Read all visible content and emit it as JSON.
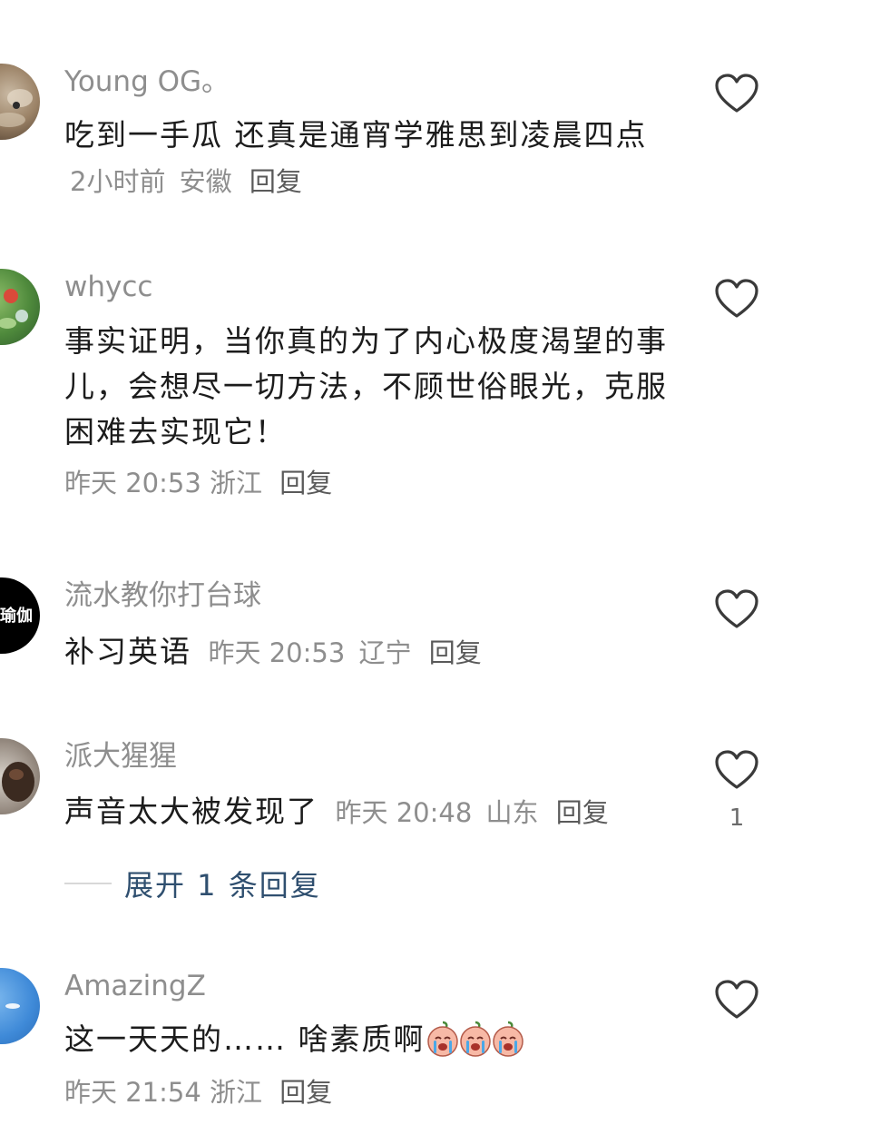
{
  "comments": [
    {
      "username": "Young OG。",
      "text": "吃到一手瓜 还真是通宵学雅思到凌晨四点",
      "time": "2小时前",
      "location": "安徽",
      "reply": "回复",
      "likes": ""
    },
    {
      "username": "whycc",
      "text": "事实证明，当你真的为了内心极度渴望的事儿，会想尽一切方法，不顾世俗眼光，克服困难去实现它！",
      "time": "昨天 20:53",
      "location": "浙江",
      "reply": "回复",
      "likes": ""
    },
    {
      "username": "流水教你打台球",
      "text": "补习英语",
      "time": "昨天 20:53",
      "location": "辽宁",
      "reply": "回复",
      "likes": "",
      "avatar_text": "瑜伽"
    },
    {
      "username": "派大猩猩",
      "text": "声音太大被发现了",
      "time": "昨天 20:48",
      "location": "山东",
      "reply": "回复",
      "likes": "1",
      "expand_replies": "展开 1 条回复"
    },
    {
      "username": "AmazingZ",
      "text": "这一天天的…… 啥素质啊",
      "time": "昨天 21:54",
      "location": "浙江",
      "reply": "回复",
      "likes": "",
      "emoji": "crying-face-emoji"
    }
  ],
  "colors": {
    "username": "#8e8e8e",
    "text": "#1c1c1c",
    "expand_link": "#2f4f6f",
    "heart_stroke": "#3a3a3a"
  }
}
